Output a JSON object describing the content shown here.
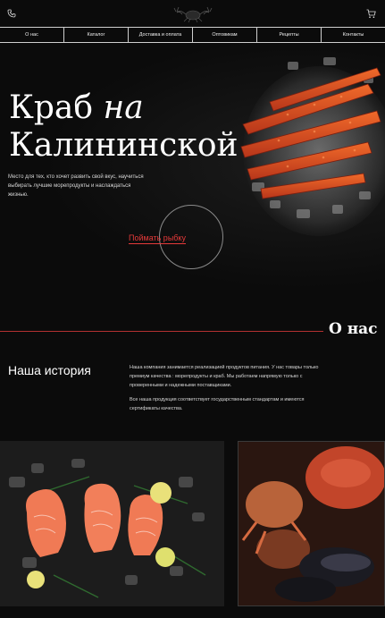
{
  "header": {
    "phone_icon": "phone-icon",
    "logo_icon": "crab-logo-icon",
    "cart_icon": "cart-icon"
  },
  "nav": {
    "items": [
      {
        "label": "О нас"
      },
      {
        "label": "Каталог"
      },
      {
        "label": "Доставка и оплата"
      },
      {
        "label": "Оптовикам"
      },
      {
        "label": "Рецепты"
      },
      {
        "label": "Контакты"
      }
    ]
  },
  "hero": {
    "title_line1": "Краб",
    "title_word": "на",
    "title_line2": "Калининской",
    "subtitle": "Место для тех, кто хочет развить свой вкус, научиться выбирать лучшие морепродукты и наслаждаться жизнью.",
    "cta_label": "Поймать рыбку"
  },
  "about": {
    "heading": "О нас",
    "story_title": "Наша история",
    "paragraph1": "Наша компания занимается реализацией продуктов питания. У нас товары только премиум качества : морепродукты и краб. Мы работаем напрямую только с проверенными и надежными поставщиками.",
    "paragraph2": "Все наша продукция соответствует государственным стандартам и имеются сертификаты качества."
  },
  "colors": {
    "accent": "#e63a3a",
    "background": "#0b0b0b",
    "text": "#e6e6e6"
  }
}
